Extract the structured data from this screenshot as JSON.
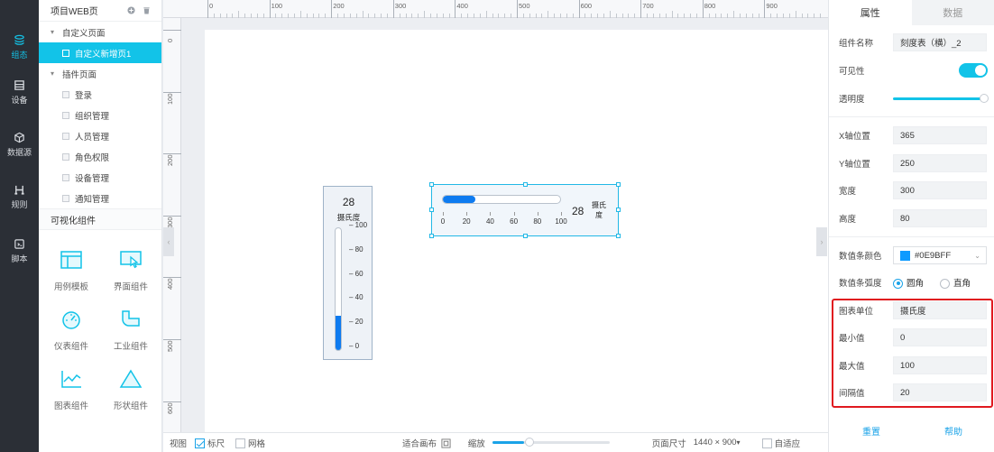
{
  "nav": [
    {
      "label": "组态",
      "icon": "layers-icon",
      "active": true
    },
    {
      "label": "设备",
      "icon": "device-icon",
      "active": false
    },
    {
      "label": "数据源",
      "icon": "cube-icon",
      "active": false
    },
    {
      "label": "规则",
      "icon": "rule-icon",
      "active": false
    },
    {
      "label": "脚本",
      "icon": "script-icon",
      "active": false
    }
  ],
  "tree": {
    "title": "项目WEB页",
    "group1": "自定义页面",
    "selected_page": "自定义新增页1",
    "group2": "插件页面",
    "pages": [
      "登录",
      "组织管理",
      "人员管理",
      "角色权限",
      "设备管理",
      "通知管理"
    ],
    "components_title": "可视化组件",
    "components": [
      "用例模板",
      "界面组件",
      "仪表组件",
      "工业组件",
      "图表组件",
      "形状组件"
    ]
  },
  "ruler": {
    "top": [
      "0",
      "100",
      "200",
      "300",
      "400",
      "500",
      "600",
      "700",
      "800",
      "900"
    ],
    "left": [
      "0",
      "100",
      "200",
      "300",
      "400",
      "500",
      "600"
    ]
  },
  "vgauge": {
    "value": "28",
    "unit": "摄氏度",
    "ticks": [
      "100",
      "80",
      "60",
      "40",
      "20",
      "0"
    ],
    "fill_percent": 28
  },
  "hgauge": {
    "value": "28",
    "unit": "摄氏度",
    "ticks": [
      "0",
      "20",
      "40",
      "60",
      "80",
      "100"
    ],
    "fill_percent": 28
  },
  "bottom": {
    "view": "视图",
    "ruler": "标尺",
    "grid": "网格",
    "fit": "适合画布",
    "zoom": "缩放",
    "page_size_label": "页面尺寸",
    "page_size": "1440 × 900",
    "adaptive": "自适应"
  },
  "props": {
    "tab_props": "属性",
    "tab_data": "数据",
    "name_label": "组件名称",
    "name_value": "刻度表（横）_2",
    "visible_label": "可见性",
    "opacity_label": "透明度",
    "x_label": "X轴位置",
    "x_value": "365",
    "y_label": "Y轴位置",
    "y_value": "250",
    "width_label": "宽度",
    "width_value": "300",
    "height_label": "高度",
    "height_value": "80",
    "bar_color_label": "数值条颜色",
    "bar_color_value": "#0E9BFF",
    "bar_radius_label": "数值条弧度",
    "radius_round": "圆角",
    "radius_straight": "直角",
    "unit_label": "图表单位",
    "unit_value": "摄氏度",
    "min_label": "最小值",
    "min_value": "0",
    "max_label": "最大值",
    "max_value": "100",
    "step_label": "间隔值",
    "step_value": "20",
    "reset": "重置",
    "help": "帮助"
  },
  "colors": {
    "accent": "#12c3e8",
    "bar": "#0e7bf0",
    "highlight": "#e0191f",
    "swatch": "#0E9BFF"
  }
}
